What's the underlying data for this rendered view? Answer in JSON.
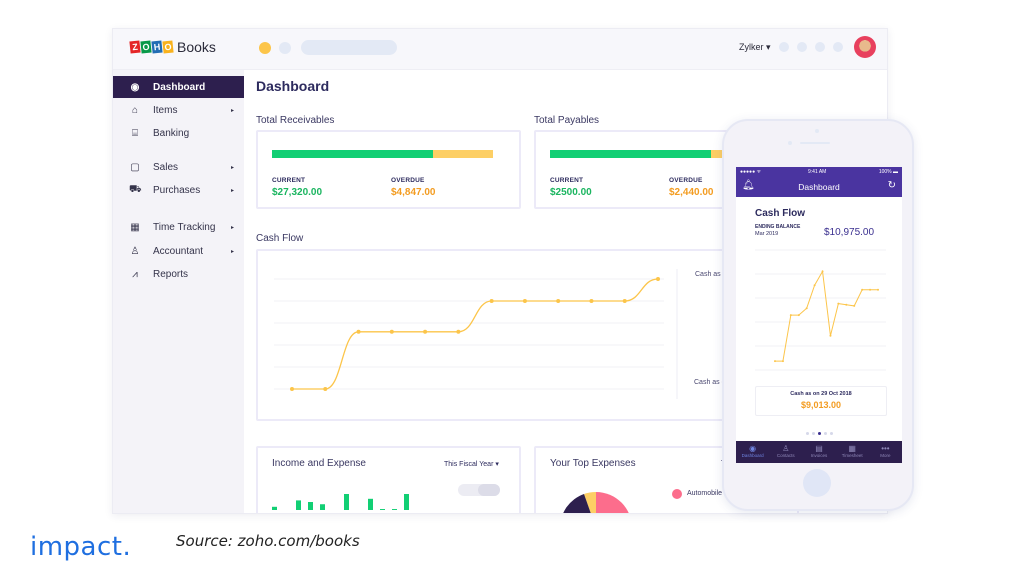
{
  "app": {
    "brand_letters": [
      "Z",
      "O",
      "H",
      "O"
    ],
    "brand_name": "Books",
    "org_switcher": "Zylker ▾"
  },
  "sidebar": {
    "items": [
      {
        "label": "Dashboard",
        "icon": "dashboard-icon",
        "glyph": "◉",
        "has_submenu": false,
        "active": true
      },
      {
        "label": "Items",
        "icon": "basket-icon",
        "glyph": "⌂",
        "has_submenu": true
      },
      {
        "label": "Banking",
        "icon": "bank-icon",
        "glyph": "⌸",
        "has_submenu": false
      },
      {
        "label": "Sales",
        "icon": "shopping-bag-icon",
        "glyph": "▢",
        "has_submenu": true
      },
      {
        "label": "Purchases",
        "icon": "cart-icon",
        "glyph": "⛟",
        "has_submenu": true
      },
      {
        "label": "Time Tracking",
        "icon": "calendar-icon",
        "glyph": "▦",
        "has_submenu": true
      },
      {
        "label": "Accountant",
        "icon": "accountant-icon",
        "glyph": "♙",
        "has_submenu": true
      },
      {
        "label": "Reports",
        "icon": "reports-icon",
        "glyph": "⩘",
        "has_submenu": false
      }
    ],
    "chevron": "▸"
  },
  "main": {
    "title": "Dashboard",
    "receivables": {
      "title": "Total Receivables",
      "current_label": "CURRENT",
      "current_value": "$27,320.00",
      "overdue_label": "OVERDUE",
      "overdue_value": "$4,847.00",
      "current_share": 0.73
    },
    "payables": {
      "title": "Total Payables",
      "current_label": "CURRENT",
      "current_value": "$2500.00",
      "overdue_label": "OVERDUE",
      "overdue_value": "$2,440.00",
      "current_share": 0.73
    },
    "cash_flow": {
      "title": "Cash Flow",
      "legend_top": "Cash as c",
      "legend_bottom": "Cash as o"
    },
    "income_expense": {
      "title": "Income and Expense",
      "period": "This Fiscal Year ▾"
    },
    "top_expenses": {
      "title": "Your Top Expenses",
      "period_partial": "T",
      "legend_item": "Automobile E"
    }
  },
  "phone": {
    "status_left": "●●●●● ᯤ",
    "status_time": "9:41 AM",
    "status_right": "100% ▬",
    "header_title": "Dashboard",
    "card_title": "Cash Flow",
    "ending_balance_label": "ENDING BALANCE",
    "ending_balance_date": "Mar 2019",
    "ending_balance_value": "$10,975.00",
    "cash_as_on_label": "Cash as on  29 Oct 2018",
    "cash_as_on_value": "$9,013.00",
    "tabs": [
      {
        "label": "Dashboard",
        "glyph": "◉",
        "active": true
      },
      {
        "label": "Contacts",
        "glyph": "♙"
      },
      {
        "label": "Invoices",
        "glyph": "▤"
      },
      {
        "label": "Timesheet",
        "glyph": "▦"
      },
      {
        "label": "More",
        "glyph": "•••"
      }
    ]
  },
  "footer": {
    "logo": "impact.",
    "source": "Source: zoho.com/books"
  },
  "colors": {
    "brand_dark": "#2d1f4e",
    "phone_header": "#4a34a0",
    "current_green": "#12cf74",
    "overdue_yellow": "#fdcf65",
    "line_yellow": "#fcc54a"
  },
  "chart_data": [
    {
      "type": "line",
      "title": "Cash Flow",
      "x": [
        1,
        2,
        3,
        4,
        5,
        6,
        7,
        8,
        9,
        10,
        11,
        12
      ],
      "values": [
        0,
        0,
        2.6,
        2.6,
        2.6,
        2.6,
        4,
        4,
        4,
        4,
        4,
        5
      ],
      "xlabel": "",
      "ylabel": "",
      "ylim": [
        0,
        5
      ],
      "grid": true
    },
    {
      "type": "line",
      "title": "Cash Flow (mobile)",
      "x": [
        1,
        2,
        3,
        4,
        5,
        6,
        7,
        8,
        9,
        10,
        11,
        12,
        13,
        14
      ],
      "values": [
        0.3,
        0.3,
        2.3,
        2.3,
        2.6,
        3.6,
        4.2,
        1.4,
        2.8,
        2.75,
        2.7,
        3.4,
        3.4,
        3.4
      ],
      "ylim": [
        0,
        5
      ],
      "grid": true
    },
    {
      "type": "bar",
      "title": "Income and Expense",
      "values": [
        1,
        0,
        3,
        2.5,
        1.8,
        0,
        5,
        0,
        3.5,
        0.3,
        0.3,
        5
      ],
      "ylim": [
        0,
        5
      ]
    }
  ]
}
